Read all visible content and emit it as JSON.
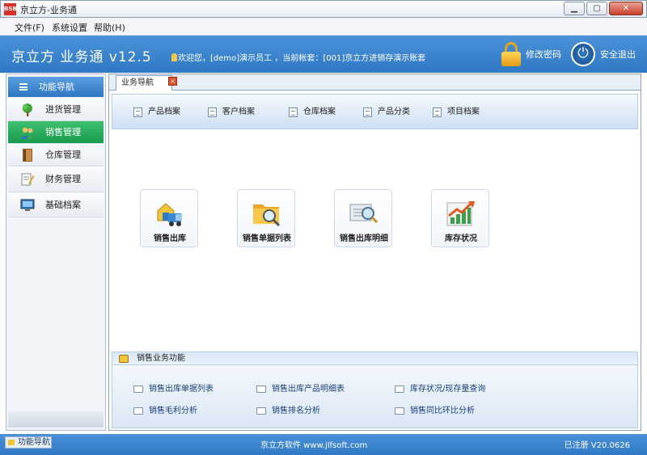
{
  "window": {
    "app_icon_text": "BSB",
    "title": "京立方-业务通"
  },
  "menu": [
    {
      "label": "文件(F)"
    },
    {
      "label": "系统设置"
    },
    {
      "label": "帮助(H)"
    }
  ],
  "header": {
    "app_name": "京立方 业务通 v12.5",
    "user_info": "欢迎您，[demo]演示员工 ，当前帐套：[001]京立方进销存演示账套",
    "change_password": "修改密码",
    "safe_exit": "安全退出"
  },
  "sidebar": {
    "title": "功能导航",
    "items": [
      {
        "label": "进货管理",
        "icon": "tree-icon",
        "active": false
      },
      {
        "label": "销售管理",
        "icon": "users-icon",
        "active": true
      },
      {
        "label": "仓库管理",
        "icon": "warehouse-book-icon",
        "active": false
      },
      {
        "label": "财务管理",
        "icon": "finance-note-icon",
        "active": false
      },
      {
        "label": "基础档案",
        "icon": "monitor-icon",
        "active": false
      }
    ]
  },
  "tab": {
    "label": "业务导航"
  },
  "quick_links": [
    {
      "label": "产品档案"
    },
    {
      "label": "客户档案"
    },
    {
      "label": "仓库档案"
    },
    {
      "label": "产品分类"
    },
    {
      "label": "项目档案"
    }
  ],
  "tiles": [
    {
      "label": "销售出库",
      "icon": "delivery-truck-icon"
    },
    {
      "label": "销售单据列表",
      "icon": "folder-search-icon"
    },
    {
      "label": "销售出库明细",
      "icon": "document-search-icon"
    },
    {
      "label": "库存状况",
      "icon": "growth-chart-icon"
    }
  ],
  "functions_panel": {
    "title": "销售业务功能",
    "links": [
      {
        "label": "销售出库单据列表"
      },
      {
        "label": "销售出库产品明细表"
      },
      {
        "label": "库存状况/现存量查询"
      },
      {
        "label": "销售毛利分析"
      },
      {
        "label": "销售排名分析"
      },
      {
        "label": "销售同比环比分析"
      }
    ]
  },
  "statusbar": {
    "nav_label": "功能导航",
    "company": "京立方软件 www.jlfsoft.com",
    "registration": "已注册  V20.0626"
  },
  "colors": {
    "header_blue": "#2f78c4",
    "active_green": "#199a4d",
    "close_red": "#c8402c"
  }
}
